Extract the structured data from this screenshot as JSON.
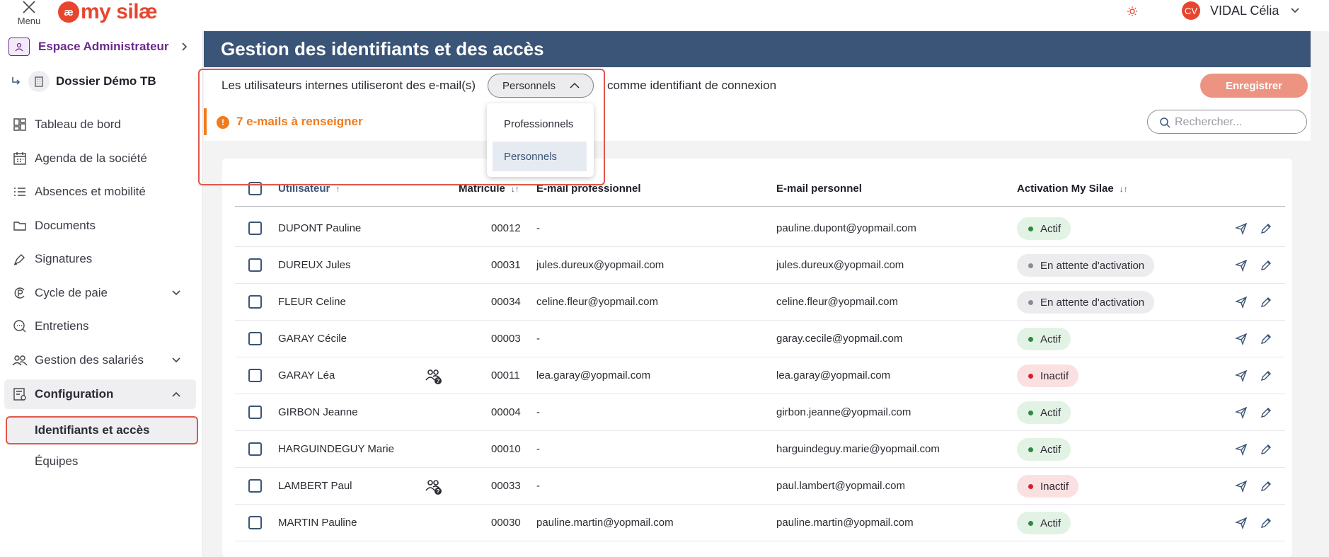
{
  "topbar": {
    "menu_label": "Menu",
    "logo_mark": "æ",
    "logo_text": "my silæ",
    "user_initials": "CV",
    "user_name": "VIDAL Célia"
  },
  "sidebar": {
    "admin_label": "Espace Administrateur",
    "dossier_label": "Dossier Démo TB",
    "items": [
      {
        "label": "Tableau de bord",
        "icon": "dashboard-icon"
      },
      {
        "label": "Agenda de la société",
        "icon": "calendar-icon"
      },
      {
        "label": "Absences et mobilité",
        "icon": "list-icon"
      },
      {
        "label": "Documents",
        "icon": "folder-icon"
      },
      {
        "label": "Signatures",
        "icon": "pen-icon"
      },
      {
        "label": "Cycle de paie",
        "icon": "payroll-icon"
      },
      {
        "label": "Entretiens",
        "icon": "chat-icon"
      },
      {
        "label": "Gestion des salariés",
        "icon": "people-icon"
      },
      {
        "label": "Configuration",
        "icon": "config-icon"
      }
    ],
    "sub_items": [
      "Identifiants et accès",
      "Équipes"
    ]
  },
  "main": {
    "title": "Gestion des identifiants et des accès",
    "settings_text_before": "Les utilisateurs internes utiliseront des e-mail(s)",
    "settings_text_after": "comme identifiant de connexion",
    "dropdown_value": "Personnels",
    "dropdown_options": [
      "Professionnels",
      "Personnels"
    ],
    "save_label": "Enregistrer",
    "alert_text": "7 e-mails à renseigner",
    "search_placeholder": "Rechercher..."
  },
  "table": {
    "headers": {
      "user": "Utilisateur",
      "matricule": "Matricule",
      "pro_email": "E-mail professionnel",
      "perso_email": "E-mail personnel",
      "activation": "Activation My Silae"
    },
    "rows": [
      {
        "name": "DUPONT Pauline",
        "matricule": "00012",
        "pro": "-",
        "perso": "pauline.dupont@yopmail.com",
        "status": "Actif",
        "kind": "actif",
        "group": false
      },
      {
        "name": "DUREUX Jules",
        "matricule": "00031",
        "pro": "jules.dureux@yopmail.com",
        "perso": "jules.dureux@yopmail.com",
        "status": "En attente d'activation",
        "kind": "wait",
        "group": false
      },
      {
        "name": "FLEUR Celine",
        "matricule": "00034",
        "pro": "celine.fleur@yopmail.com",
        "perso": "celine.fleur@yopmail.com",
        "status": "En attente d'activation",
        "kind": "wait",
        "group": false
      },
      {
        "name": "GARAY Cécile",
        "matricule": "00003",
        "pro": "-",
        "perso": "garay.cecile@yopmail.com",
        "status": "Actif",
        "kind": "actif",
        "group": false
      },
      {
        "name": "GARAY Léa",
        "matricule": "00011",
        "pro": "lea.garay@yopmail.com",
        "perso": "lea.garay@yopmail.com",
        "status": "Inactif",
        "kind": "inact",
        "group": true
      },
      {
        "name": "GIRBON Jeanne",
        "matricule": "00004",
        "pro": "-",
        "perso": "girbon.jeanne@yopmail.com",
        "status": "Actif",
        "kind": "actif",
        "group": false
      },
      {
        "name": "HARGUINDEGUY Marie",
        "matricule": "00010",
        "pro": "-",
        "perso": "harguindeguy.marie@yopmail.com",
        "status": "Actif",
        "kind": "actif",
        "group": false
      },
      {
        "name": "LAMBERT Paul",
        "matricule": "00033",
        "pro": "-",
        "perso": "paul.lambert@yopmail.com",
        "status": "Inactif",
        "kind": "inact",
        "group": true
      },
      {
        "name": "MARTIN Pauline",
        "matricule": "00030",
        "pro": "pauline.martin@yopmail.com",
        "perso": "pauline.martin@yopmail.com",
        "status": "Actif",
        "kind": "actif",
        "group": false
      }
    ]
  },
  "colors": {
    "brand": "#e8452f",
    "header": "#3a5577",
    "admin": "#6b2a8c",
    "alert": "#f07b1e",
    "highlight": "#e0574a"
  }
}
